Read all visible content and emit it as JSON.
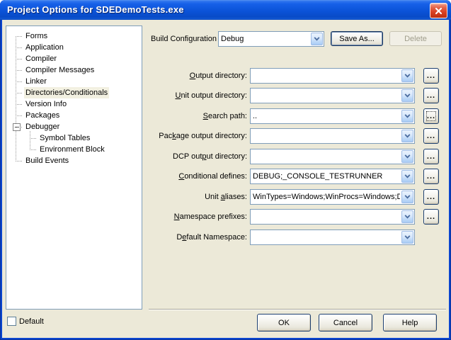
{
  "window": {
    "title": "Project Options for SDEDemoTests.exe"
  },
  "tree": {
    "items": [
      {
        "label": "Forms",
        "level": 0
      },
      {
        "label": "Application",
        "level": 0
      },
      {
        "label": "Compiler",
        "level": 0
      },
      {
        "label": "Compiler Messages",
        "level": 0
      },
      {
        "label": "Linker",
        "level": 0
      },
      {
        "label": "Directories/Conditionals",
        "level": 0,
        "selected": true
      },
      {
        "label": "Version Info",
        "level": 0
      },
      {
        "label": "Packages",
        "level": 0
      },
      {
        "label": "Debugger",
        "level": 0,
        "expanded": true
      },
      {
        "label": "Symbol Tables",
        "level": 1
      },
      {
        "label": "Environment Block",
        "level": 1
      },
      {
        "label": "Build Events",
        "level": 0
      }
    ]
  },
  "build": {
    "label": "Build Configuration",
    "value": "Debug",
    "save_as_label": "Save As...",
    "delete_label": "Delete"
  },
  "ui": {
    "browse_label": "...",
    "face_color": "#ECE9D8",
    "titlebar_color": "#0B53D8",
    "combo_border_color": "#7F9DB9",
    "selection_color": "#F2F0E1"
  },
  "fields": [
    {
      "pre": "",
      "accel": "O",
      "post": "utput directory:",
      "value": ""
    },
    {
      "pre": "",
      "accel": "U",
      "post": "nit output directory:",
      "value": ""
    },
    {
      "pre": "",
      "accel": "S",
      "post": "earch path:",
      "value": ".."
    },
    {
      "pre": "Pac",
      "accel": "k",
      "post": "age output directory:",
      "value": ""
    },
    {
      "pre": "DCP out",
      "accel": "p",
      "post": "ut directory:",
      "value": ""
    },
    {
      "pre": "",
      "accel": "C",
      "post": "onditional defines:",
      "value": "DEBUG;_CONSOLE_TESTRUNNER"
    },
    {
      "pre": "Unit ",
      "accel": "a",
      "post": "liases:",
      "value": "WinTypes=Windows;WinProcs=Windows;DbiT"
    },
    {
      "pre": "",
      "accel": "N",
      "post": "amespace prefixes:",
      "value": ""
    },
    {
      "pre": "D",
      "accel": "e",
      "post": "fault Namespace:",
      "value": ""
    }
  ],
  "footer": {
    "default_label": "Default",
    "ok_label": "OK",
    "cancel_label": "Cancel",
    "help_label": "Help"
  }
}
